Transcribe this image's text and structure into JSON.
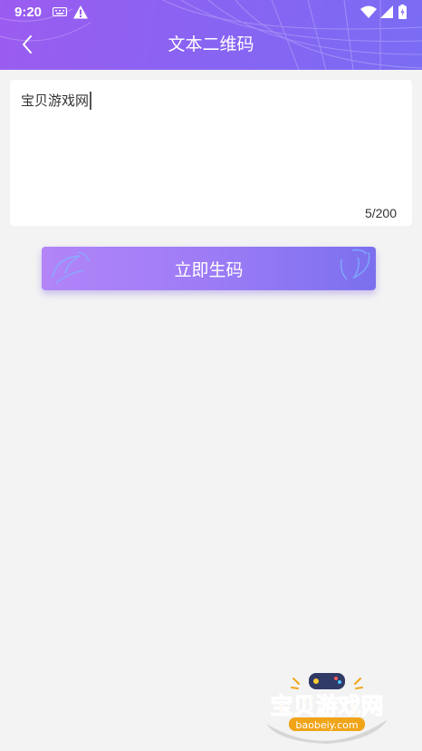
{
  "status_bar": {
    "time": "9:20"
  },
  "header": {
    "title": "文本二维码"
  },
  "text_input": {
    "value": "宝贝游戏网",
    "counter": "5/200"
  },
  "generate_button": {
    "label": "立即生码"
  },
  "watermark": {
    "name": "宝贝游戏网",
    "url": "baobeiy.com"
  },
  "colors": {
    "header_start": "#9b5cf0",
    "header_end": "#7a6cf3",
    "button_start": "#b284f8",
    "button_end": "#7b70ee",
    "background": "#f3f3f3"
  }
}
